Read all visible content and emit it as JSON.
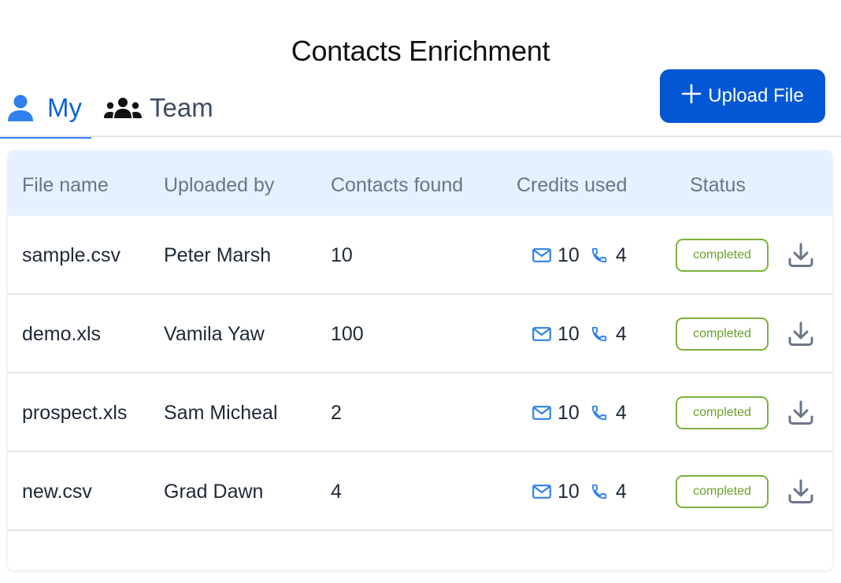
{
  "page": {
    "title": "Contacts Enrichment"
  },
  "tabs": [
    {
      "label": "My",
      "icon": "user-icon",
      "active": true
    },
    {
      "label": "Team",
      "icon": "users-icon",
      "active": false
    }
  ],
  "toolbar": {
    "upload_label": "Upload File",
    "upload_icon": "plus-icon"
  },
  "colors": {
    "accent": "#0457d4",
    "active_tab": "#0e62d6",
    "header_bg": "#e5f1fe",
    "status_completed": "#7bb13b",
    "credit_icon": "#2f80ed"
  },
  "table": {
    "columns": [
      "File name",
      "Uploaded by",
      "Contacts found",
      "Credits used",
      "Status"
    ],
    "rows": [
      {
        "file_name": "sample.csv",
        "uploaded_by": "Peter Marsh",
        "contacts_found": "10",
        "email_credits": "10",
        "phone_credits": "4",
        "status": "completed"
      },
      {
        "file_name": "demo.xls",
        "uploaded_by": "Vamila Yaw",
        "contacts_found": "100",
        "email_credits": "10",
        "phone_credits": "4",
        "status": "completed"
      },
      {
        "file_name": "prospect.xls",
        "uploaded_by": "Sam Micheal",
        "contacts_found": "2",
        "email_credits": "10",
        "phone_credits": "4",
        "status": "completed"
      },
      {
        "file_name": "new.csv",
        "uploaded_by": "Grad Dawn",
        "contacts_found": "4",
        "email_credits": "10",
        "phone_credits": "4",
        "status": "completed"
      }
    ]
  }
}
